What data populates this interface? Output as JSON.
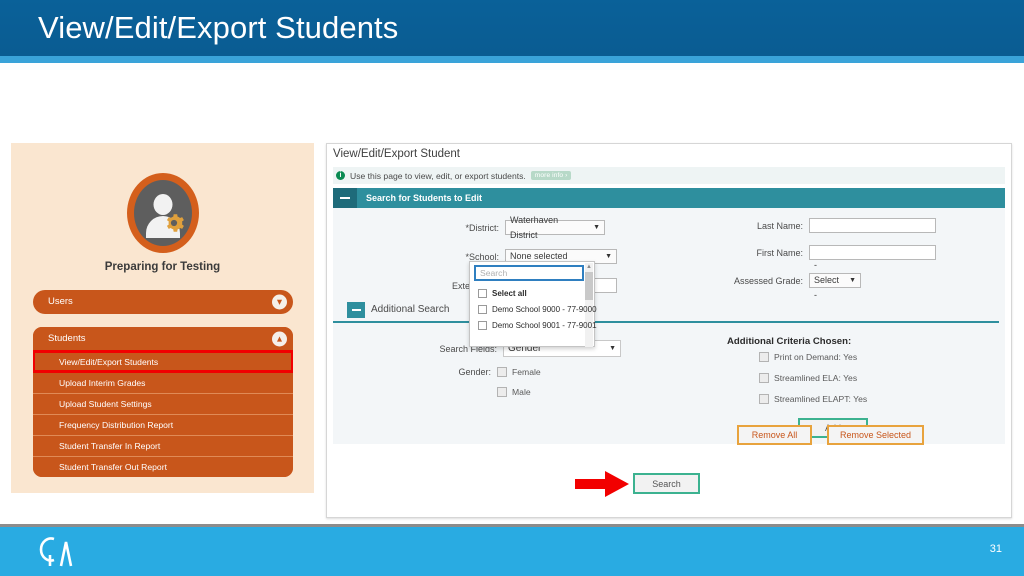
{
  "slide": {
    "title": "View/Edit/Export Students",
    "page_number": "31",
    "header_color": "#0a5e95",
    "header_underline_color": "#3aa3d9",
    "footer_color": "#29abe2",
    "logo_text": "CA"
  },
  "sidebar": {
    "caption": "Preparing for Testing",
    "panel_color": "#fae6d0",
    "item_color": "#c8561b",
    "highlight_color": "#f20000",
    "users": {
      "label": "Users",
      "chevron": "⌄"
    },
    "students": {
      "label": "Students",
      "chevron": "⌃"
    },
    "sub_items": [
      {
        "label": "View/Edit/Export Students",
        "highlighted": true
      },
      {
        "label": "Upload Interim Grades",
        "highlighted": false
      },
      {
        "label": "Upload Student Settings",
        "highlighted": false
      },
      {
        "label": "Frequency Distribution Report",
        "highlighted": false
      },
      {
        "label": "Student Transfer In Report",
        "highlighted": false
      },
      {
        "label": "Student Transfer Out Report",
        "highlighted": false
      }
    ]
  },
  "app": {
    "page_title": "View/Edit/Export Student",
    "info_icon": "i",
    "info_text": "Use this page to view, edit, or export students.",
    "more_info_label": "more info ›",
    "section_title": "Search for Students to Edit",
    "section_color": "#2e8f9e",
    "form": {
      "district_label": "*District:",
      "district_value": "Waterhaven District",
      "school_label": "*School:",
      "school_value": "None selected",
      "external_id_label": "External ID:",
      "last_name_label": "Last Name:",
      "last_name_value": "",
      "first_name_label": "First Name:",
      "first_name_value": "",
      "assessed_grade_label": "Assessed Grade:",
      "assessed_grade_value": "- Select -"
    },
    "school_dropdown": {
      "search_placeholder": "Search",
      "options": [
        "Select all",
        "Demo School 9000 - 77-9000",
        "Demo School 9001 - 77-9001"
      ]
    },
    "additional_search": {
      "title": "Additional Search",
      "search_fields_label": "Search Fields:",
      "search_fields_value": "Gender",
      "gender_label": "Gender:",
      "gender_options": [
        "Female",
        "Male"
      ],
      "add_label": "Add"
    },
    "criteria": {
      "title": "Additional Criteria Chosen:",
      "items": [
        "Print on Demand: Yes",
        "Streamlined ELA: Yes",
        "Streamlined ELAPT: Yes"
      ],
      "remove_all_label": "Remove All",
      "remove_selected_label": "Remove Selected",
      "button_border_color": "#e8a33d"
    },
    "search_button_label": "Search",
    "search_button_border_color": "#3cb290",
    "arrow_color": "#f20000"
  }
}
